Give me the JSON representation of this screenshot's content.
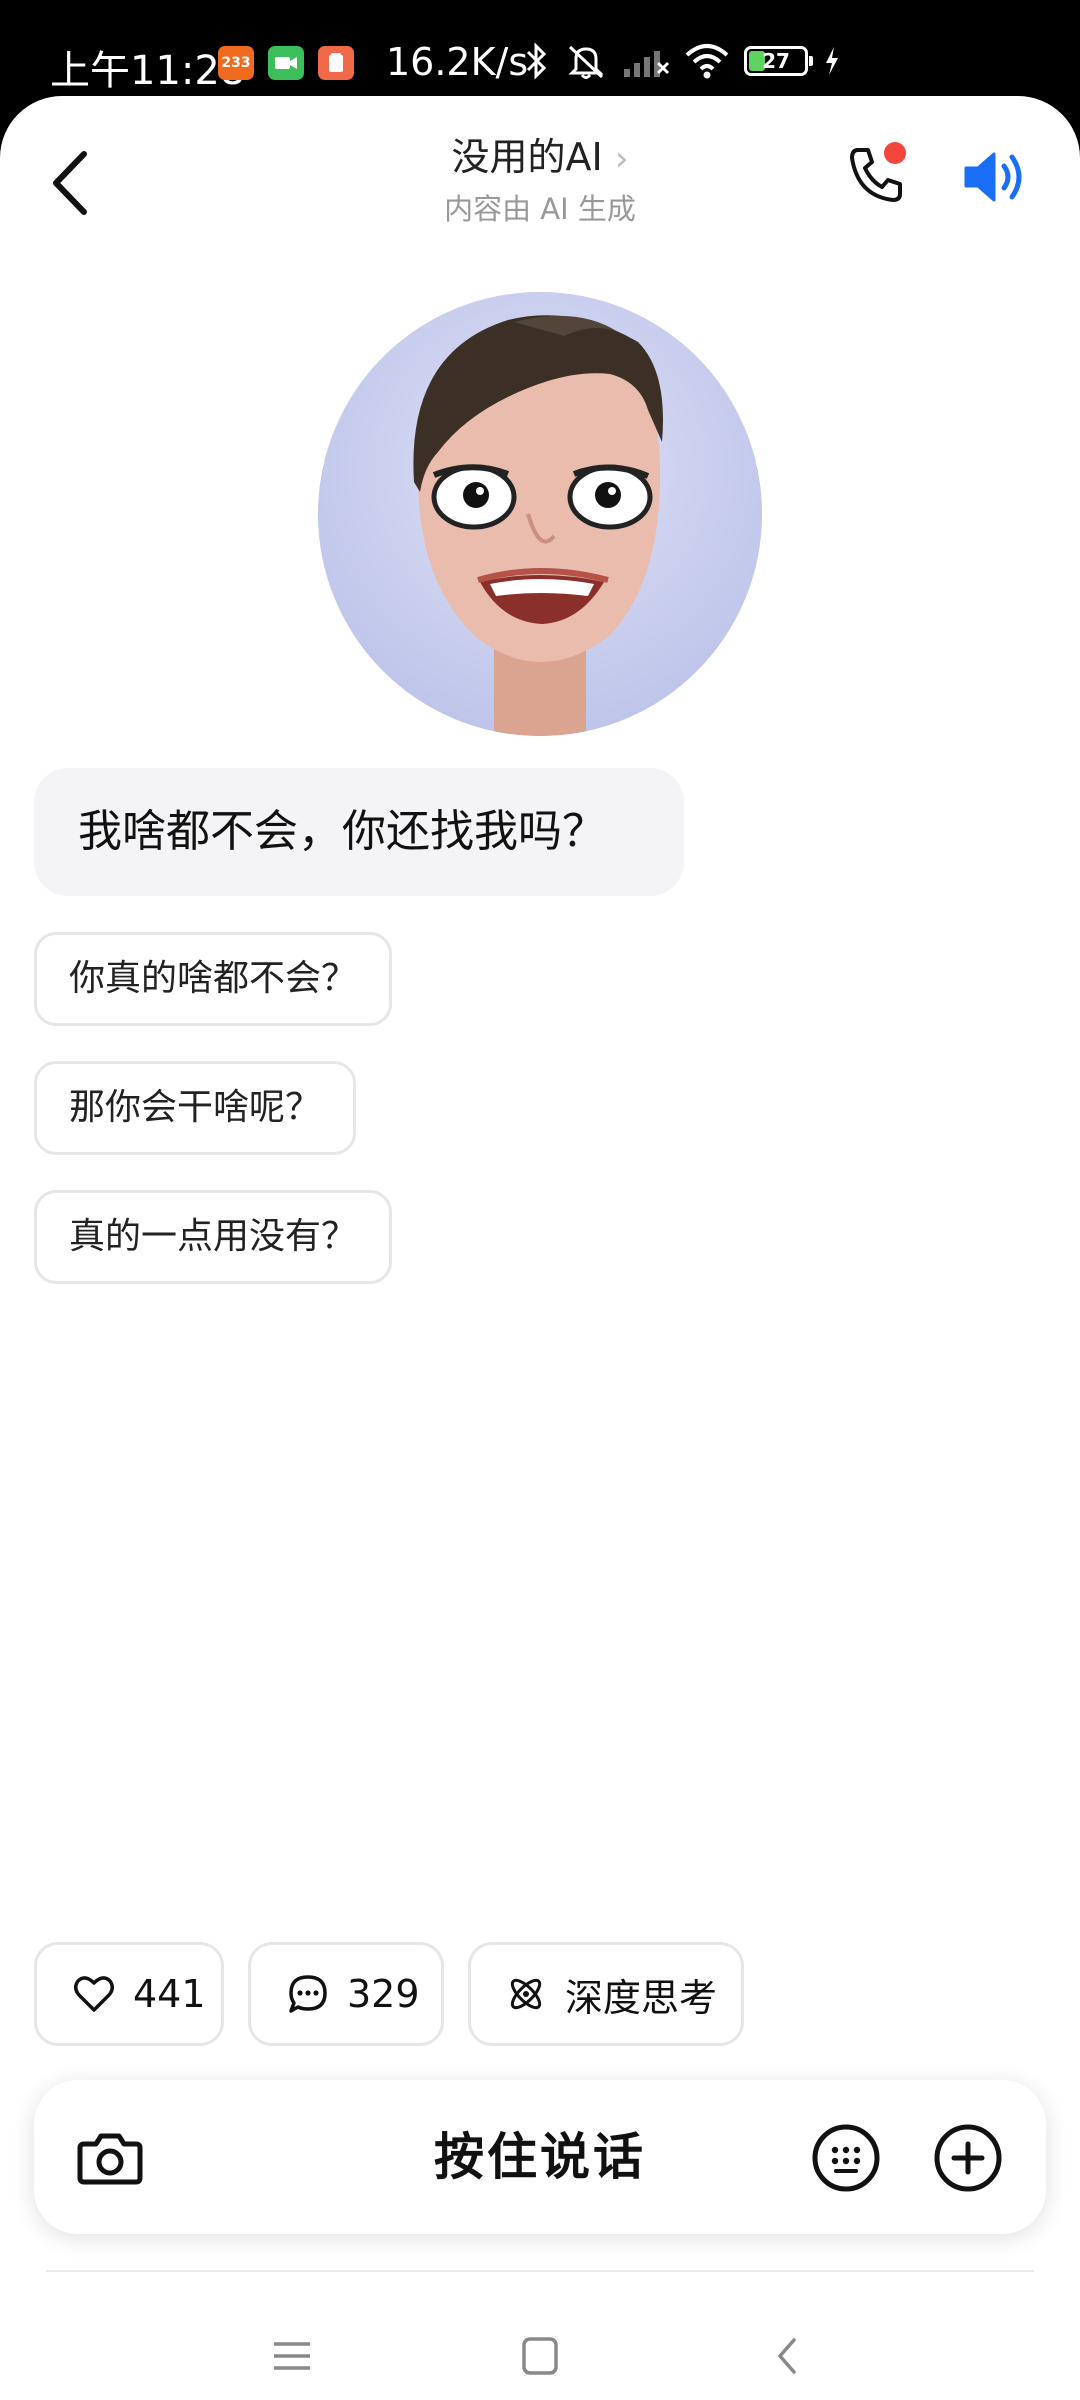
{
  "status_bar": {
    "time": "上午11:28",
    "badge_233": "233",
    "net_speed": "16.2K/s",
    "battery_level": "27",
    "icons": [
      "app-233-icon",
      "video-icon",
      "app-icon",
      "bluetooth-icon",
      "mute-icon",
      "cellular-signal-icon",
      "wifi-icon",
      "battery-icon",
      "charging-icon"
    ]
  },
  "header": {
    "title": "没用的AI",
    "title_chevron": "›",
    "subtitle": "内容由 AI 生成",
    "call_notification_color": "#f0463c",
    "speaker_color": "#1a6ef5"
  },
  "chat": {
    "ai_message": "我啥都不会，你还找我吗？",
    "suggestions": [
      "你真的啥都不会？",
      "那你会干啥呢？",
      "真的一点用没有？"
    ]
  },
  "actions": {
    "likes": "441",
    "comments": "329",
    "deep_think": "深度思考"
  },
  "input": {
    "hold_to_talk": "按住说话"
  }
}
